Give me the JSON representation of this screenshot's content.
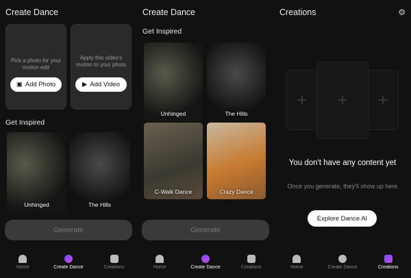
{
  "panels": [
    {
      "title": "Create Dance",
      "photo_card": {
        "hint": "Pick a photo for your motion edit",
        "button": "Add Photo",
        "icon": "image-icon"
      },
      "video_card": {
        "hint": "Apply this video's motion to your photo",
        "button": "Add Video",
        "icon": "play-icon"
      },
      "inspired": "Get Inspired",
      "tiles": [
        "Unhinged",
        "The Hills"
      ],
      "generate": "Generate"
    },
    {
      "title": "Create Dance",
      "inspired": "Get Inspired",
      "tiles": [
        "Unhinged",
        "The Hills",
        "C-Walk Dance",
        "Crazy Dance"
      ],
      "generate": "Generate"
    },
    {
      "title": "Creations",
      "settings_icon": "gear-icon",
      "empty_title": "You don't have any content yet",
      "empty_sub": "Once you generate, they'll show up here",
      "explore": "Explore Dance AI"
    }
  ],
  "nav": [
    "Home",
    "Create Dance",
    "Creations"
  ],
  "accent": "#8a4dff"
}
